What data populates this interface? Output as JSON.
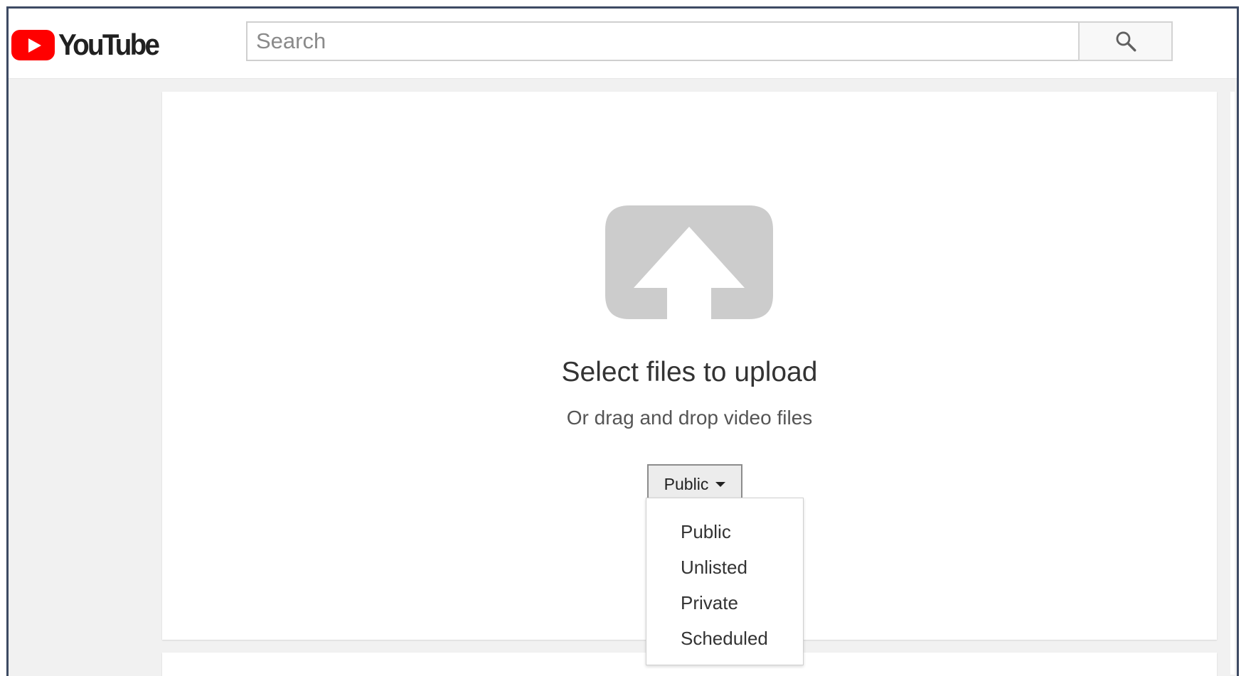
{
  "header": {
    "logo_text": "YouTube",
    "search_placeholder": "Search"
  },
  "upload": {
    "title": "Select files to upload",
    "subtitle": "Or drag and drop video files",
    "privacy_selected": "Public"
  },
  "privacy_menu": {
    "items": [
      "Public",
      "Unlisted",
      "Private",
      "Scheduled"
    ]
  },
  "icons": {
    "logo": "youtube-play-icon",
    "search": "search-icon",
    "upload": "upload-arrow-icon",
    "dropdown": "caret-down-icon"
  },
  "colors": {
    "brand_red": "#ff0000",
    "upload_icon_gray": "#cccccc",
    "page_bg": "#f1f1f1"
  }
}
